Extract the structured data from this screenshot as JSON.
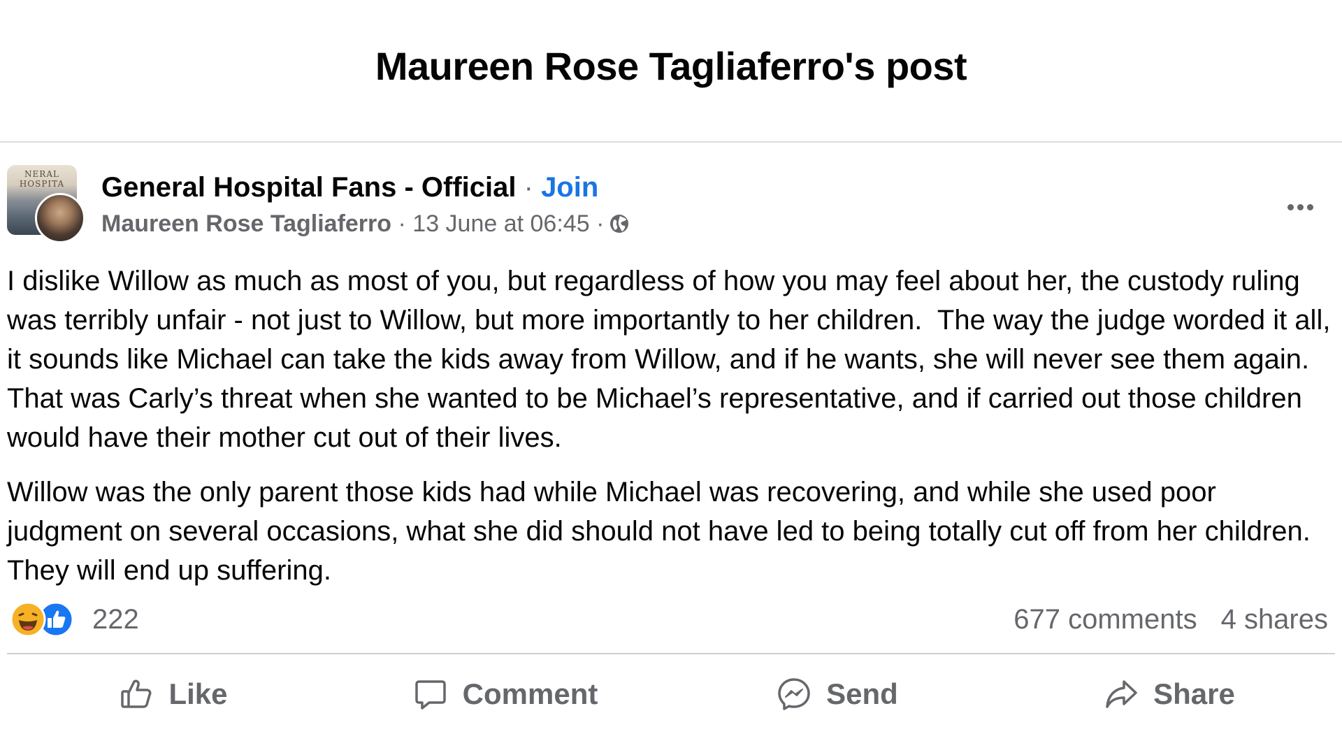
{
  "dialog": {
    "title": "Maureen Rose Tagliaferro's post"
  },
  "post": {
    "group_name": "General Hospital Fans - Official",
    "separator": "·",
    "join_label": "Join",
    "author": "Maureen Rose Tagliaferro",
    "timestamp": "13 June at 06:45",
    "meta_separator": "·",
    "privacy_icon": "globe-icon",
    "group_avatar_text": "NERAL HOSPITA",
    "paragraphs": [
      "I dislike Willow as much as most of you, but regardless of how you may feel about her, the custody ruling was terribly unfair - not just to Willow, but more importantly to her children.  The way the judge worded it all, it sounds like Michael can take the kids away from Willow, and if he wants, she will never see them again.  That was Carly’s threat when she wanted to be Michael’s representative, and if carried out those children would have their mother cut out of their lives.",
      "Willow was the only parent those kids had while Michael was recovering, and while she used poor judgment on several occasions, what she did should not have led to being totally cut off from her children.   They will end up suffering."
    ]
  },
  "engagement": {
    "reaction_icons": [
      "haha-icon",
      "like-reaction-icon"
    ],
    "reaction_count": "222",
    "comments": "677 comments",
    "shares": "4 shares"
  },
  "actions": {
    "like": "Like",
    "comment": "Comment",
    "send": "Send",
    "share": "Share"
  },
  "colors": {
    "text_primary": "#050505",
    "text_secondary": "#65676b",
    "accent_blue": "#1b74e4",
    "divider": "#ced0d4"
  }
}
